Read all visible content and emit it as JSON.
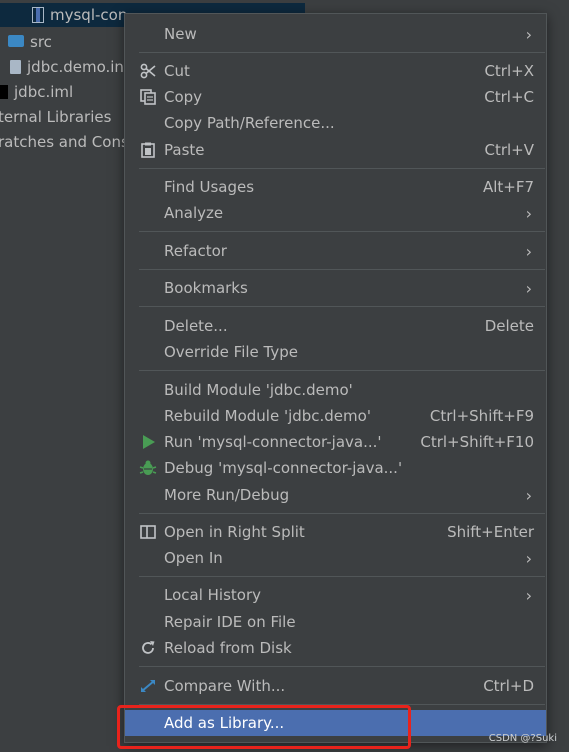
{
  "tree": {
    "selected_item": "mysql-con",
    "items": [
      {
        "label": "src",
        "icon": "folder-icon"
      },
      {
        "label": "jdbc.demo.in",
        "icon": "file-icon"
      },
      {
        "label": "jdbc.iml",
        "icon": "iml-file-icon"
      },
      {
        "label": "ternal Libraries",
        "icon": ""
      },
      {
        "label": "ratches and Cons",
        "icon": ""
      }
    ]
  },
  "menu": {
    "items": {
      "new": {
        "label": "New",
        "arrow": "›"
      },
      "cut": {
        "label": "Cut",
        "shortcut": "Ctrl+X"
      },
      "copy": {
        "label": "Copy",
        "shortcut": "Ctrl+C"
      },
      "copy_path": {
        "label": "Copy Path/Reference..."
      },
      "paste": {
        "label": "Paste",
        "shortcut": "Ctrl+V"
      },
      "find_usages": {
        "label": "Find Usages",
        "shortcut": "Alt+F7"
      },
      "analyze": {
        "label": "Analyze",
        "arrow": "›"
      },
      "refactor": {
        "label": "Refactor",
        "arrow": "›"
      },
      "bookmarks": {
        "label": "Bookmarks",
        "arrow": "›"
      },
      "delete": {
        "label": "Delete...",
        "shortcut": "Delete"
      },
      "override_file_type": {
        "label": "Override File Type"
      },
      "build_module": {
        "label": "Build Module 'jdbc.demo'"
      },
      "rebuild_module": {
        "label": "Rebuild Module 'jdbc.demo'",
        "shortcut": "Ctrl+Shift+F9"
      },
      "run": {
        "label": "Run 'mysql-connector-java...'",
        "shortcut": "Ctrl+Shift+F10"
      },
      "debug": {
        "label": "Debug 'mysql-connector-java...'"
      },
      "more_run_debug": {
        "label": "More Run/Debug",
        "arrow": "›"
      },
      "open_right_split": {
        "label": "Open in Right Split",
        "shortcut": "Shift+Enter"
      },
      "open_in": {
        "label": "Open In",
        "arrow": "›"
      },
      "local_history": {
        "label": "Local History",
        "arrow": "›"
      },
      "repair_ide": {
        "label": "Repair IDE on File"
      },
      "reload_from_disk": {
        "label": "Reload from Disk"
      },
      "compare_with": {
        "label": "Compare With...",
        "shortcut": "Ctrl+D"
      },
      "add_as_library": {
        "label": "Add as Library..."
      }
    }
  },
  "colors": {
    "selection": "#4b6eaf",
    "highlight_box": "#e8231c",
    "run_icon": "#499c54"
  },
  "watermark": "CSDN @?Suki"
}
